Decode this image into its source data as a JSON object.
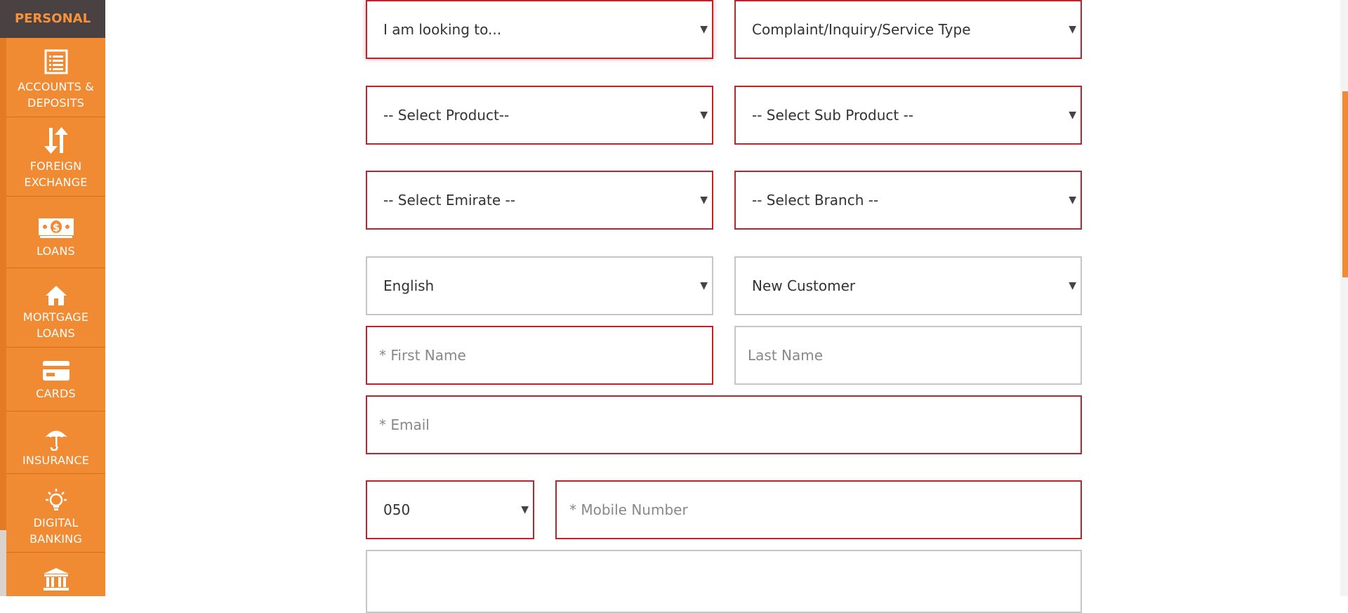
{
  "sidebar": {
    "header": "PERSONAL",
    "items": [
      {
        "label": "ACCOUNTS &\nDEPOSITS",
        "icon": "list-icon"
      },
      {
        "label": "FOREIGN\nEXCHANGE",
        "icon": "up-down-arrows-icon"
      },
      {
        "label": "LOANS",
        "icon": "banknote-icon"
      },
      {
        "label": "MORTGAGE\nLOANS",
        "icon": "house-icon"
      },
      {
        "label": "CARDS",
        "icon": "card-icon"
      },
      {
        "label": "INSURANCE",
        "icon": "umbrella-icon"
      },
      {
        "label": "DIGITAL\nBANKING",
        "icon": "lightbulb-icon"
      },
      {
        "label": "",
        "icon": "bank-icon"
      }
    ]
  },
  "form": {
    "looking_to": "I am looking to...",
    "complaint_type": "Complaint/Inquiry/Service Type",
    "product": "-- Select Product--",
    "sub_product": "-- Select Sub Product --",
    "emirate": "-- Select Emirate --",
    "branch": "-- Select Branch --",
    "language": "English",
    "customer_type": "New Customer",
    "first_name_placeholder": "* First Name",
    "last_name_placeholder": "Last Name",
    "email_placeholder": "* Email",
    "mobile_prefix": "050",
    "mobile_placeholder": "* Mobile Number"
  },
  "colors": {
    "accent": "#f08a33",
    "header_bg": "#4a4242",
    "error_border": "#b3282e",
    "neutral_border": "#c6c6c6"
  }
}
